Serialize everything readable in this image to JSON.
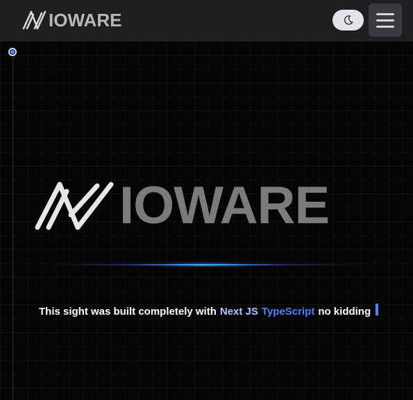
{
  "navbar": {
    "brand_text": "IOWARE",
    "theme_toggle_icon": "moon-icon",
    "menu_icon": "hamburger-icon"
  },
  "hero": {
    "logo_text": "IOWARE",
    "tagline": {
      "prefix": "This sight was built completely with",
      "next_js": "Next JS",
      "typescript": "TypeScript",
      "suffix": "no kidding"
    }
  },
  "colors": {
    "background": "#050505",
    "navbar": "#1f1f22",
    "accent_blue": "#4a82ff",
    "light_blue": "#a9c8ff",
    "logo_gray": "#7b7b7d"
  }
}
